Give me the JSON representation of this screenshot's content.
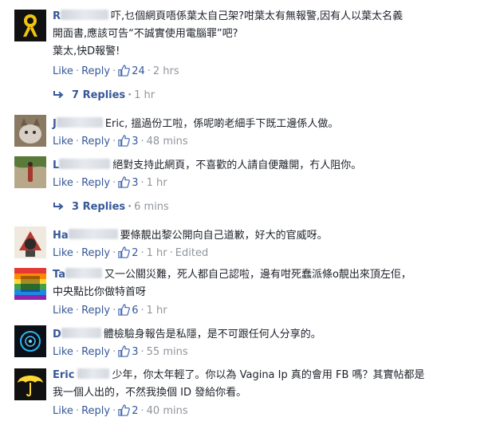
{
  "actions": {
    "like": "Like",
    "reply": "Reply",
    "sep": "·"
  },
  "comments": [
    {
      "name_visible": "R",
      "text_lines": [
        "吓,乜個網頁唔係葉太自己架?咁葉太有無報警,因有人以葉太名義",
        "開面書,應該可告“不誠實使用電腦罪”吧?",
        "葉太,快D報警!"
      ],
      "likes": "24",
      "time": "2 hrs",
      "avatar": "yellow-ribbon"
    },
    {
      "name_visible": "J",
      "text_lines": [
        "Eric, 搵過份工啦，係呢啲老細手下既工邊係人做。"
      ],
      "likes": "3",
      "time": "48 mins",
      "avatar": "cat-photo"
    },
    {
      "name_visible": "L",
      "text_lines": [
        "絕對支持此網頁，不喜歡的人請自便離開，冇人阻你。"
      ],
      "likes": "3",
      "time": "1 hr",
      "avatar": "outdoor-photo"
    },
    {
      "name_visible": "Ha",
      "text_lines": [
        "要條靚出黎公開向自己道歉，好大的官威呀。"
      ],
      "likes": "2",
      "time": "1 hr",
      "edited": "Edited",
      "avatar": "cartoon"
    },
    {
      "name_visible": "Ta",
      "text_lines": [
        "又一公關災難，死人都自己認啦，邊有咁死蠢派條o靚出來頂左佢，",
        "中央點比你做特首呀"
      ],
      "likes": "6",
      "time": "1 hr",
      "avatar": "rainbow-poster"
    },
    {
      "name_visible": "D",
      "text_lines": [
        "體檢驗身報告是私隱，是不可跟任何人分享的。"
      ],
      "likes": "3",
      "time": "55 mins",
      "avatar": "circle-logo"
    },
    {
      "name_visible": "Eric",
      "text_lines": [
        "少年，你太年輕了。你以為 Vagina Ip 真的會用 FB 嗎？其實帖都是",
        "我一個人出的，不然我換個 ID 發給你看。"
      ],
      "likes": "2",
      "time": "40 mins",
      "avatar": "yellow-umbrella"
    }
  ],
  "replies": [
    {
      "label": "7 Replies",
      "time": "1 hr"
    },
    {
      "label": "3 Replies",
      "time": "6 mins"
    }
  ]
}
